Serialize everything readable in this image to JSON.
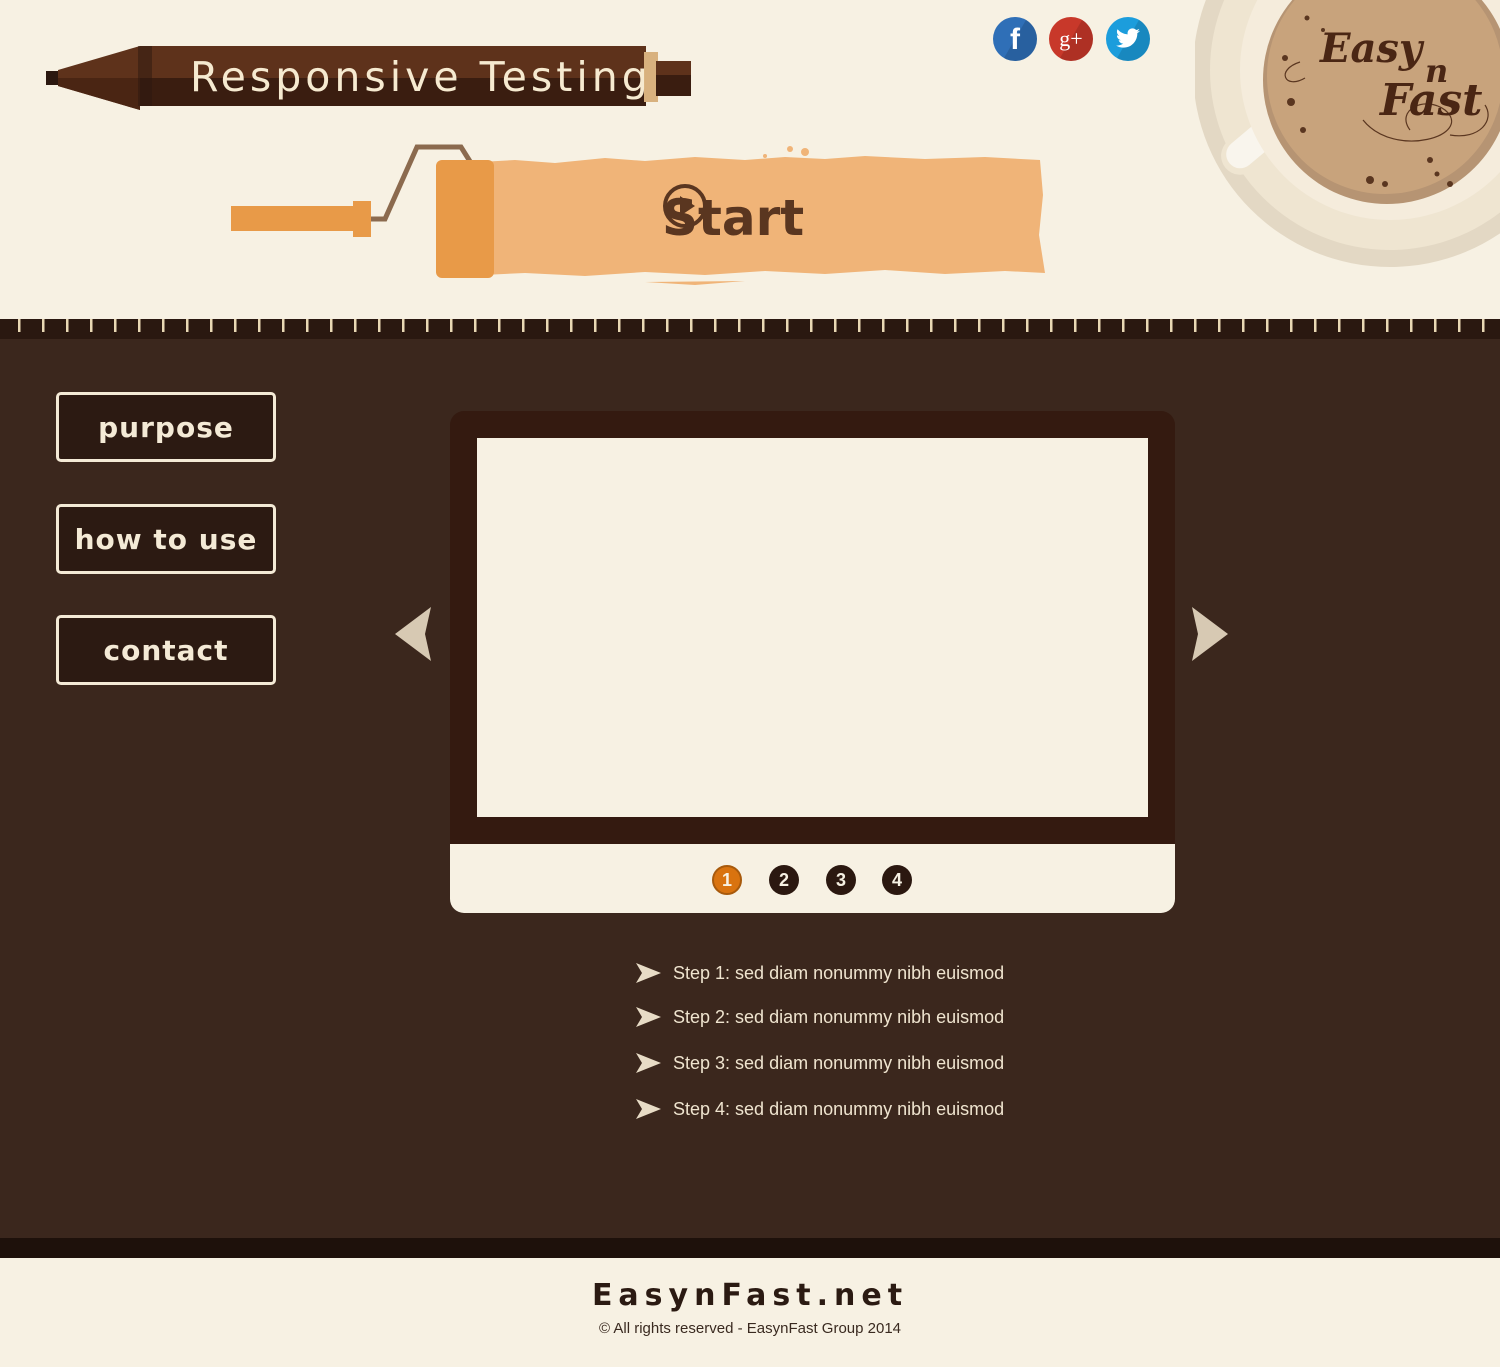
{
  "header": {
    "title": "Responsive Testing",
    "start_label": "Start",
    "icons": {
      "start": "play-circle-icon"
    },
    "social": [
      {
        "name": "facebook",
        "glyph": "f",
        "icon": "facebook-icon",
        "color": "#2f6fb7"
      },
      {
        "name": "google-plus",
        "glyph": "g+",
        "icon": "google-plus-icon",
        "color": "#c8382a"
      },
      {
        "name": "twitter",
        "glyph": "twitter",
        "icon": "twitter-bird-icon",
        "color": "#1c9ddc"
      }
    ],
    "logo": {
      "word1": "Easy",
      "word2": "n",
      "word3": "Fast"
    }
  },
  "nav": {
    "items": [
      {
        "id": "purpose",
        "label": "purpose"
      },
      {
        "id": "how-to-use",
        "label": "how to use"
      },
      {
        "id": "contact",
        "label": "contact"
      }
    ]
  },
  "slider": {
    "prev_icon": "triangle-left-icon",
    "next_icon": "triangle-right-icon",
    "dots": [
      "1",
      "2",
      "3",
      "4"
    ],
    "active_dot": "1"
  },
  "steps": [
    "Step 1: sed diam nonummy nibh euismod",
    "Step 2: sed diam nonummy nibh euismod",
    "Step 3: sed diam nonummy nibh euismod",
    "Step 4: sed diam nonummy nibh euismod"
  ],
  "footer": {
    "site": "EasynFast.net",
    "copyright": "©  All rights reserved - EasynFast Group 2014"
  },
  "colors": {
    "cream": "#f7f1e3",
    "brown_dark": "#3b271d",
    "brown_frame": "#341a10",
    "orange": "#e89a48",
    "orange_light": "#f0b478",
    "accent_dot": "#d9730f"
  }
}
